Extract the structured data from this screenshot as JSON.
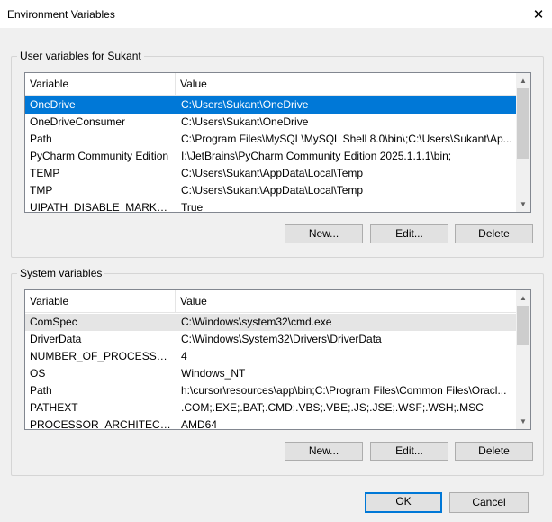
{
  "window": {
    "title": "Environment Variables",
    "close_label": "✕"
  },
  "user_vars": {
    "group_label": "User variables for Sukant",
    "col_variable": "Variable",
    "col_value": "Value",
    "rows": [
      {
        "name": "OneDrive",
        "value": "C:\\Users\\Sukant\\OneDrive"
      },
      {
        "name": "OneDriveConsumer",
        "value": "C:\\Users\\Sukant\\OneDrive"
      },
      {
        "name": "Path",
        "value": "C:\\Program Files\\MySQL\\MySQL Shell 8.0\\bin\\;C:\\Users\\Sukant\\Ap..."
      },
      {
        "name": "PyCharm Community Edition",
        "value": "I:\\JetBrains\\PyCharm Community Edition 2025.1.1.1\\bin;"
      },
      {
        "name": "TEMP",
        "value": "C:\\Users\\Sukant\\AppData\\Local\\Temp"
      },
      {
        "name": "TMP",
        "value": "C:\\Users\\Sukant\\AppData\\Local\\Temp"
      },
      {
        "name": "UIPATH_DISABLE_MARKETPL...",
        "value": "True"
      }
    ],
    "new_label": "New...",
    "edit_label": "Edit...",
    "delete_label": "Delete"
  },
  "system_vars": {
    "group_label": "System variables",
    "col_variable": "Variable",
    "col_value": "Value",
    "rows": [
      {
        "name": "ComSpec",
        "value": "C:\\Windows\\system32\\cmd.exe"
      },
      {
        "name": "DriverData",
        "value": "C:\\Windows\\System32\\Drivers\\DriverData"
      },
      {
        "name": "NUMBER_OF_PROCESSORS",
        "value": "4"
      },
      {
        "name": "OS",
        "value": "Windows_NT"
      },
      {
        "name": "Path",
        "value": "h:\\cursor\\resources\\app\\bin;C:\\Program Files\\Common Files\\Oracl..."
      },
      {
        "name": "PATHEXT",
        "value": ".COM;.EXE;.BAT;.CMD;.VBS;.VBE;.JS;.JSE;.WSF;.WSH;.MSC"
      },
      {
        "name": "PROCESSOR_ARCHITECTURE",
        "value": "AMD64"
      }
    ],
    "new_label": "New...",
    "edit_label": "Edit...",
    "delete_label": "Delete"
  },
  "dialog": {
    "ok_label": "OK",
    "cancel_label": "Cancel"
  },
  "colors": {
    "selection": "#0078d7",
    "hover_row": "#e5e5e5",
    "background": "#f0f0f0"
  }
}
